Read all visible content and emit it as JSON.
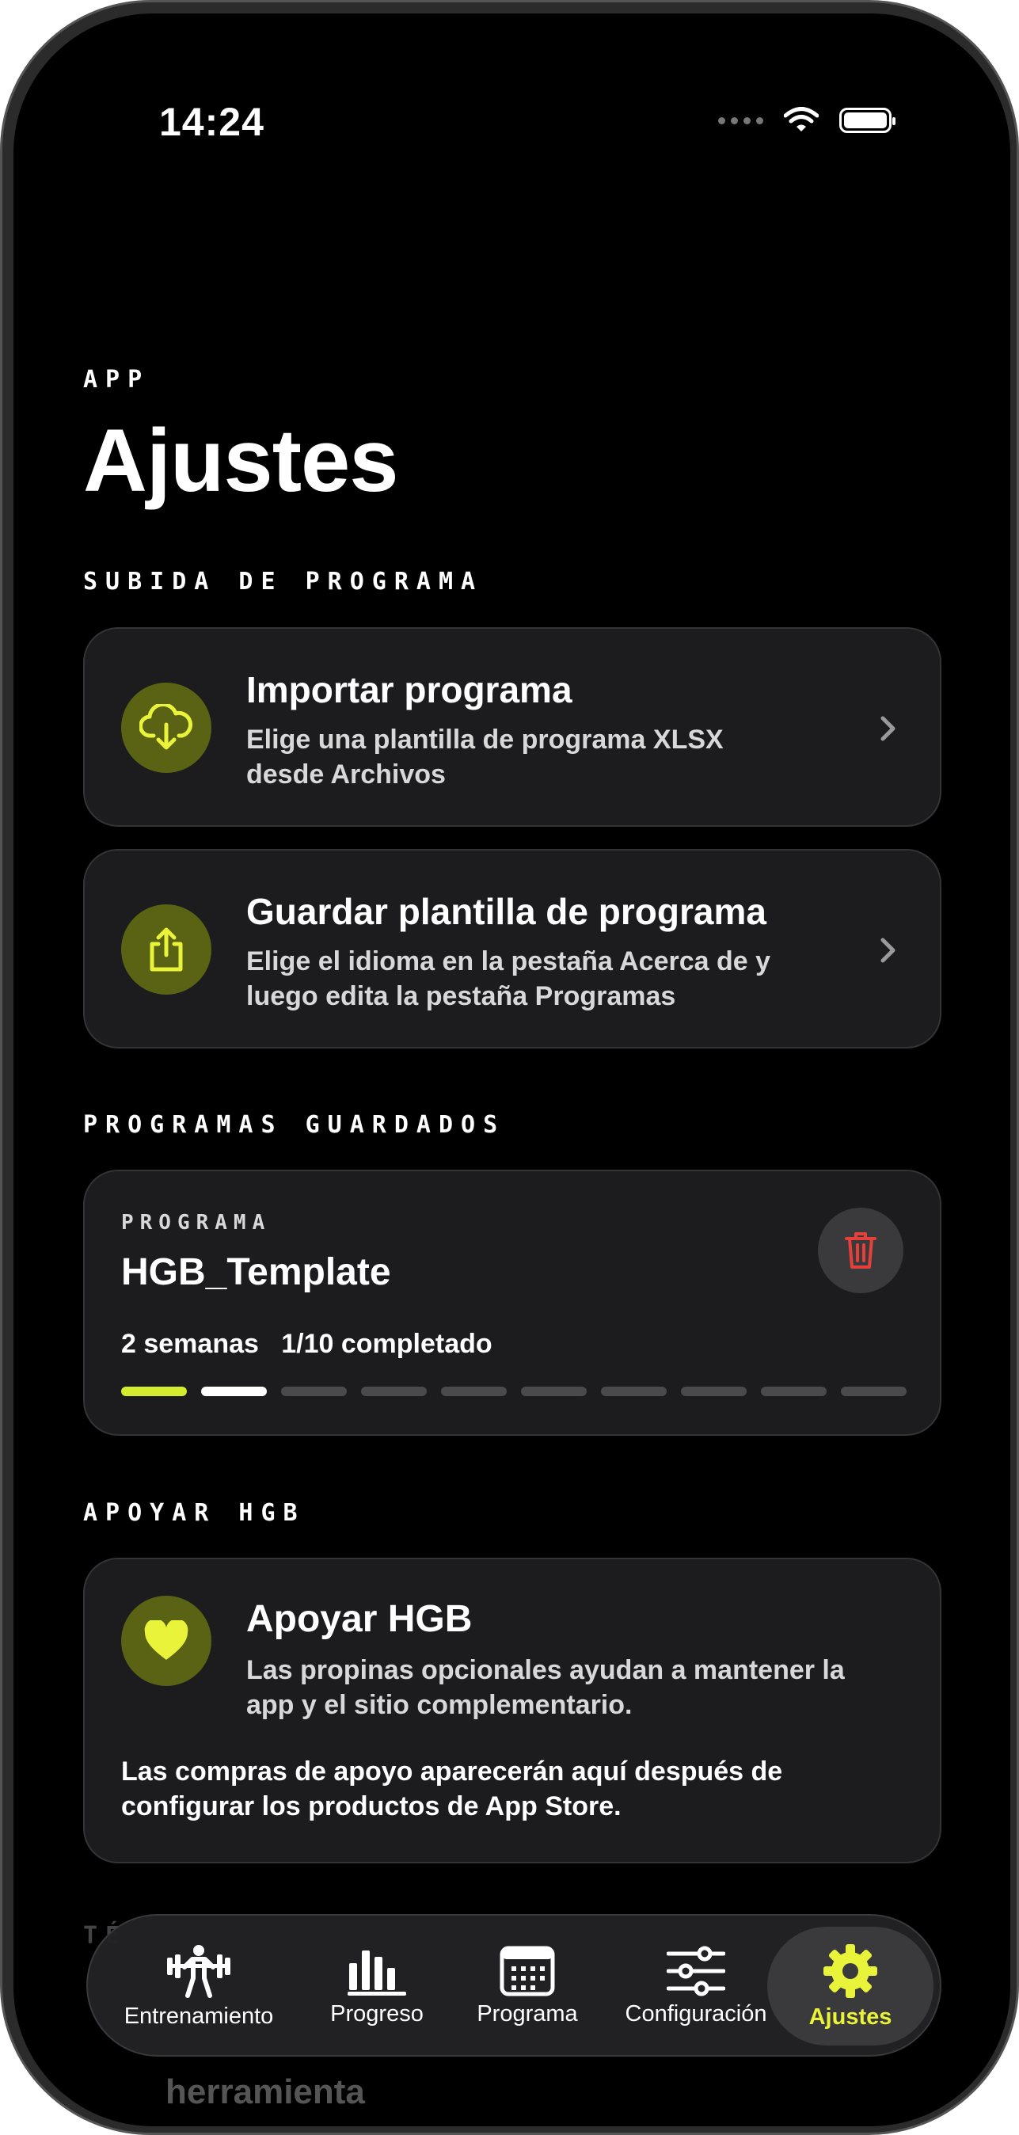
{
  "status_bar": {
    "time": "14:24"
  },
  "header": {
    "kicker": "APP",
    "title": "Ajustes"
  },
  "sections": {
    "upload": "SUBIDA DE PROGRAMA",
    "saved": "PROGRAMAS GUARDADOS",
    "support": "APOYAR HGB",
    "tools_partial": "TÉ"
  },
  "upload_rows": [
    {
      "title": "Importar programa",
      "subtitle_line1": "Elige una plantilla de programa XLSX",
      "subtitle_line2": "desde Archivos",
      "icon": "cloud-download-icon"
    },
    {
      "title": "Guardar plantilla de programa",
      "subtitle_line1": "Elige el idioma en la pestaña Acerca de y",
      "subtitle_line2": "luego edita la pestaña Programas",
      "icon": "share-export-icon"
    }
  ],
  "saved_program": {
    "kicker": "PROGRAMA",
    "name": "HGB_Template",
    "weeks": "2 semanas",
    "completed": "1/10 completado",
    "progress": {
      "completed": 1,
      "current": 2,
      "total": 10
    }
  },
  "support": {
    "title": "Apoyar HGB",
    "subtitle_line1": "Las propinas opcionales ayudan a mantener la",
    "subtitle_line2": "app y el sitio complementario.",
    "note_line1": "Las compras de apoyo aparecerán aquí después de",
    "note_line2": "configurar los productos de App Store."
  },
  "partial_behind": {
    "title_fragment": "herramienta"
  },
  "tabs": [
    {
      "label": "Entrenamiento",
      "icon": "weightlifter-icon",
      "active": false
    },
    {
      "label": "Progreso",
      "icon": "bar-chart-icon",
      "active": false
    },
    {
      "label": "Programa",
      "icon": "calendar-icon",
      "active": false
    },
    {
      "label": "Configuración",
      "icon": "sliders-icon",
      "active": false
    },
    {
      "label": "Ajustes",
      "icon": "gear-icon",
      "active": true
    }
  ],
  "colors": {
    "accent": "#e8f33a",
    "progress_done": "#d4ec2e",
    "icon_circle": "#5a6214",
    "danger": "#e5403a",
    "card": "#1c1c1e"
  }
}
